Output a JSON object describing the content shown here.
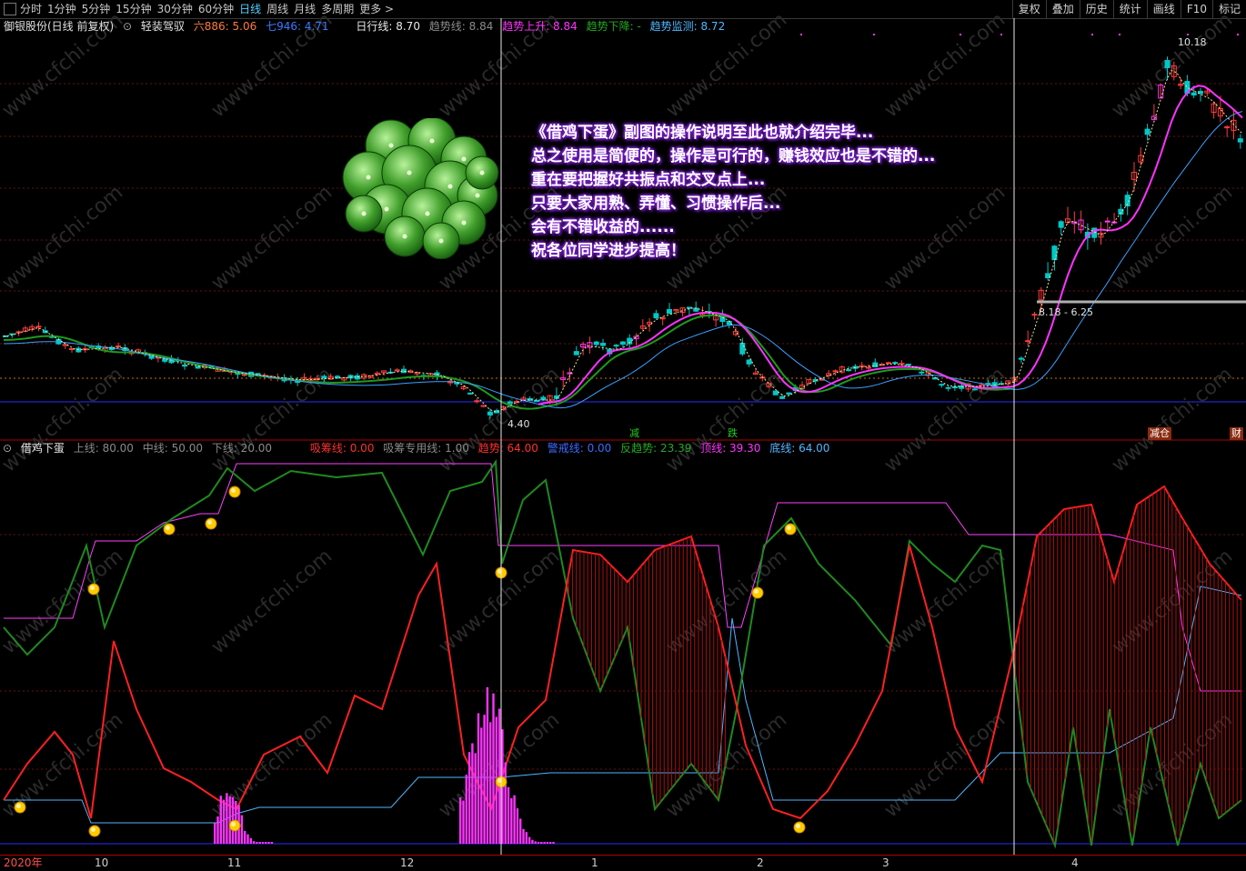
{
  "toolbar": {
    "periods": [
      "分时",
      "1分钟",
      "5分钟",
      "15分钟",
      "30分钟",
      "60分钟",
      "日线",
      "周线",
      "月线",
      "多周期",
      "更多 >"
    ],
    "active_period": "日线",
    "right_buttons": [
      "复权",
      "叠加",
      "历史",
      "统计",
      "画线",
      "F10",
      "标记"
    ]
  },
  "main_info": {
    "stock": "御银股份(日线 前复权)",
    "indicator": "轻装驾驭",
    "ma6_label": "六886: 5.06",
    "ma7_label": "七946: 4.71",
    "rixing": "日行线: 8.70",
    "trend": "趋势线: 8.84",
    "trend_up": "趋势上升: 8.84",
    "trend_down": "趋势下降: -",
    "trend_monitor": "趋势监测: 8.72"
  },
  "annotations": {
    "high_label": "10.18",
    "low_label": "4.40",
    "range_label": "8.18 - 6.25",
    "signal_1": "减",
    "signal_2": "跌",
    "signal_3": "减仓",
    "signal_4": "财"
  },
  "sub_info": {
    "name": "借鸡下蛋",
    "upper": "上线: 80.00",
    "middle": "中线: 50.00",
    "lower": "下线: 20.00",
    "absorb": "吸筹线: 0.00",
    "absorb_special": "吸筹专用线: 1.00",
    "trend": "趋势: 64.00",
    "warning": "警戒线: 0.00",
    "reverse": "反趋势: 23.39",
    "top": "顶线: 39.30",
    "bottom": "底线: 64.00"
  },
  "overlay_text": [
    "《借鸡下蛋》副图的操作说明至此也就介绍完毕...",
    "总之使用是简便的，操作是可行的，赚钱效应也是不错的...",
    "重在要把握好共振点和交叉点上...",
    "只要大家用熟、弄懂、习惯操作后...",
    "会有不错收益的......",
    "祝各位同学进步提高！"
  ],
  "xaxis": {
    "labels": [
      "2020年",
      "10",
      "11",
      "12",
      "1",
      "2",
      "3",
      "4"
    ]
  },
  "watermark": "www.cfchi.com",
  "colors": {
    "up": "#ff3b3b",
    "down": "#00c8c8",
    "magenta": "#ff33ff",
    "green": "#1a8c1a",
    "red": "#ff2020",
    "blue": "#3399ff"
  }
}
